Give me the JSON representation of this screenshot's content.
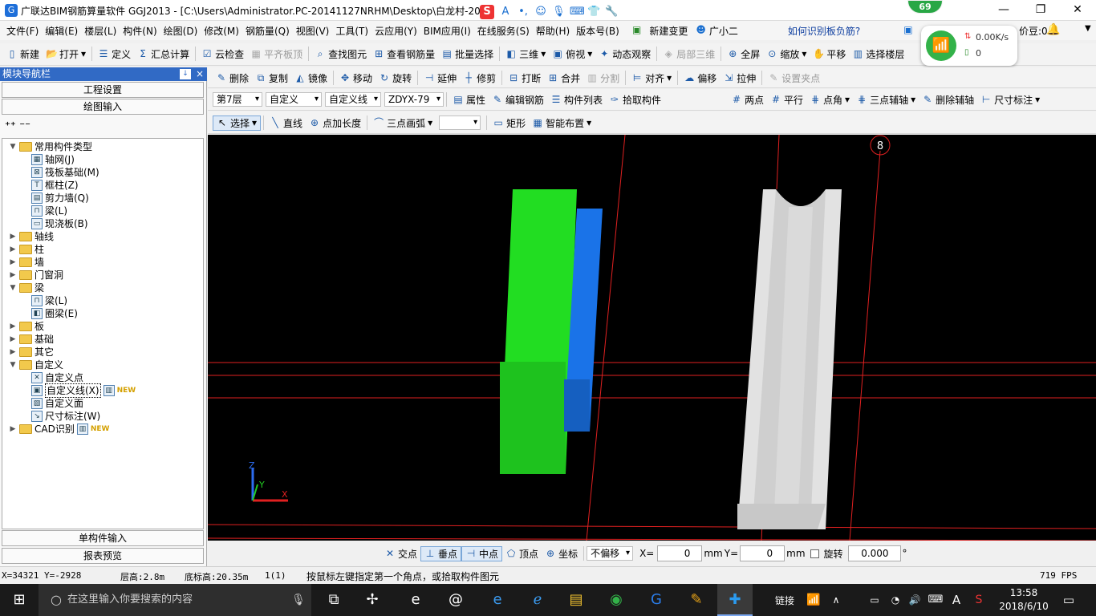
{
  "window": {
    "title": "广联达BIM钢筋算量软件 GGJ2013 - [C:\\Users\\Administrator.PC-20141127NRHM\\Desktop\\白龙村-201",
    "badge_count": "69",
    "min": "—",
    "max": "❐",
    "close": "✕"
  },
  "menu": {
    "items": [
      "文件(F)",
      "编辑(E)",
      "楼层(L)",
      "构件(N)",
      "绘图(D)",
      "修改(M)",
      "钢筋量(Q)",
      "视图(V)",
      "工具(T)",
      "云应用(Y)",
      "BIM应用(I)",
      "在线服务(S)",
      "帮助(H)",
      "版本号(B)"
    ],
    "new_change": "新建变更",
    "assistant": "广小二",
    "question": "如何识别板负筋?",
    "bean": "价豆:0"
  },
  "wifi_popup": {
    "speed": "0.00K/s",
    "count": "0"
  },
  "toolbar1": {
    "items": [
      "新建",
      "打开",
      "定义",
      "汇总计算",
      "云检查",
      "平齐板顶",
      "查找图元",
      "查看钢筋量",
      "批量选择",
      "三维",
      "俯视",
      "动态观察",
      "局部三维",
      "全屏",
      "缩放",
      "平移",
      "选择楼层"
    ]
  },
  "toolbar2": {
    "items": [
      "删除",
      "复制",
      "镜像",
      "移动",
      "旋转",
      "延伸",
      "修剪",
      "打断",
      "合并",
      "分割",
      "对齐",
      "偏移",
      "拉伸",
      "设置夹点"
    ]
  },
  "toolbar3": {
    "floor": "第7层",
    "category": "自定义",
    "type": "自定义线",
    "name": "ZDYX-79",
    "items": [
      "属性",
      "编辑钢筋",
      "构件列表",
      "拾取构件"
    ],
    "aux": [
      "两点",
      "平行",
      "点角",
      "三点辅轴",
      "删除辅轴",
      "尺寸标注"
    ]
  },
  "toolbar4": {
    "select": "选择",
    "items": [
      "直线",
      "点加长度",
      "三点画弧",
      "矩形",
      "智能布置"
    ]
  },
  "panel": {
    "title": "模块导航栏",
    "pin": "↓",
    "close": "×",
    "project_settings": "工程设置",
    "drawing_input": "绘图输入",
    "single_input": "单构件输入",
    "report_preview": "报表预览",
    "tree": [
      {
        "label": "常用构件类型",
        "level": 0,
        "kind": "folder",
        "open": true
      },
      {
        "label": "轴网(J)",
        "level": 1,
        "kind": "item"
      },
      {
        "label": "筏板基础(M)",
        "level": 1,
        "kind": "item"
      },
      {
        "label": "框柱(Z)",
        "level": 1,
        "kind": "item"
      },
      {
        "label": "剪力墙(Q)",
        "level": 1,
        "kind": "item"
      },
      {
        "label": "梁(L)",
        "level": 1,
        "kind": "item"
      },
      {
        "label": "现浇板(B)",
        "level": 1,
        "kind": "item"
      },
      {
        "label": "轴线",
        "level": 0,
        "kind": "folder"
      },
      {
        "label": "柱",
        "level": 0,
        "kind": "folder"
      },
      {
        "label": "墙",
        "level": 0,
        "kind": "folder"
      },
      {
        "label": "门窗洞",
        "level": 0,
        "kind": "folder"
      },
      {
        "label": "梁",
        "level": 0,
        "kind": "folder",
        "open": true
      },
      {
        "label": "梁(L)",
        "level": 1,
        "kind": "item"
      },
      {
        "label": "圈梁(E)",
        "level": 1,
        "kind": "item"
      },
      {
        "label": "板",
        "level": 0,
        "kind": "folder"
      },
      {
        "label": "基础",
        "level": 0,
        "kind": "folder"
      },
      {
        "label": "其它",
        "level": 0,
        "kind": "folder"
      },
      {
        "label": "自定义",
        "level": 0,
        "kind": "folder",
        "open": true
      },
      {
        "label": "自定义点",
        "level": 1,
        "kind": "item"
      },
      {
        "label": "自定义线(X)",
        "level": 1,
        "kind": "item",
        "selected": true,
        "new": "NEW"
      },
      {
        "label": "自定义面",
        "level": 1,
        "kind": "item"
      },
      {
        "label": "尺寸标注(W)",
        "level": 1,
        "kind": "item"
      },
      {
        "label": "CAD识别",
        "level": 0,
        "kind": "folder",
        "new": "NEW"
      }
    ]
  },
  "canvas": {
    "axis_label": "8",
    "z": "Z",
    "y": "Y",
    "x": "X"
  },
  "snapbar": {
    "items": [
      "交点",
      "垂点",
      "中点",
      "顶点",
      "坐标"
    ],
    "offset_mode": "不偏移",
    "x_label": "X=",
    "x_value": "0",
    "x_unit": "mm",
    "y_label": "Y=",
    "y_value": "0",
    "y_unit": "mm",
    "rotate_label": "旋转",
    "rotate_value": "0.000",
    "deg": "°"
  },
  "status": {
    "coords": "X=34321 Y=-2928",
    "floor_height": "层高:2.8m",
    "bottom_height": "底标高:20.35m",
    "count": "1(1)",
    "hint": "按鼠标左键指定第一个角点，或拾取构件图元",
    "fps": "719 FPS"
  },
  "taskbar": {
    "search_placeholder": "在这里输入你要搜索的内容",
    "link": "链接",
    "ime": "A",
    "time": "13:58",
    "date": "2018/6/10"
  }
}
